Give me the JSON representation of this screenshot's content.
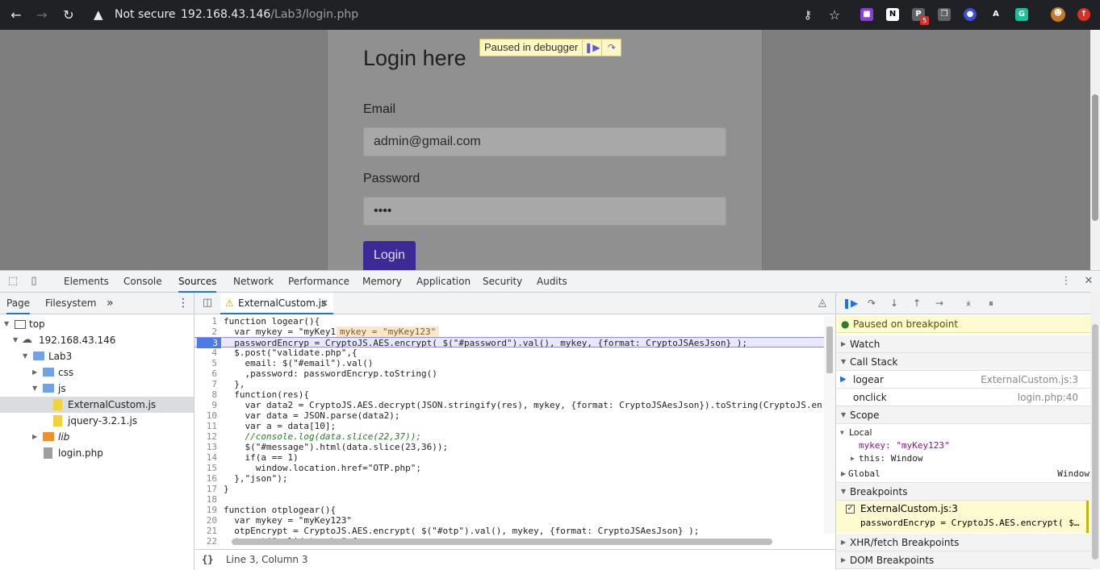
{
  "browser": {
    "url_warning": "Not secure",
    "url_host": "192.168.43.146",
    "url_path": "/Lab3/login.php",
    "ext_badge": "5"
  },
  "page": {
    "title": "Login here",
    "email_label": "Email",
    "email_value": "admin@gmail.com",
    "password_label": "Password",
    "password_value": "••••",
    "login_button": "Login",
    "paused_text": "Paused in debugger"
  },
  "devtools": {
    "tabs": [
      "Elements",
      "Console",
      "Sources",
      "Network",
      "Performance",
      "Memory",
      "Application",
      "Security",
      "Audits"
    ],
    "active_tab": "Sources",
    "navigator": {
      "tabs": [
        "Page",
        "Filesystem"
      ],
      "tree": [
        {
          "label": "top",
          "kind": "frame"
        },
        {
          "label": "192.168.43.146",
          "kind": "cloud"
        },
        {
          "label": "Lab3",
          "kind": "folder"
        },
        {
          "label": "css",
          "kind": "folder"
        },
        {
          "label": "js",
          "kind": "folder"
        },
        {
          "label": "ExternalCustom.js",
          "kind": "js"
        },
        {
          "label": "jquery-3.2.1.js",
          "kind": "js"
        },
        {
          "label": "lib",
          "kind": "folder-lib"
        },
        {
          "label": "login.php",
          "kind": "file"
        }
      ]
    },
    "editor": {
      "file_tab": "ExternalCustom.js",
      "status": "Line 3, Column 3",
      "lines": [
        {
          "n": "1",
          "text": "function logear(){"
        },
        {
          "n": "2",
          "text": "  var mykey = \"myKey123\";"
        },
        {
          "n": "3",
          "text": "  passwordEncryp = CryptoJS.AES.encrypt( $(\"#password\").val(), mykey, {format: CryptoJSAesJson} );"
        },
        {
          "n": "4",
          "text": "  $.post(\"validate.php\",{"
        },
        {
          "n": "5",
          "text": "    email: $(\"#email\").val()"
        },
        {
          "n": "6",
          "text": "    ,password: passwordEncryp.toString()"
        },
        {
          "n": "7",
          "text": "  },"
        },
        {
          "n": "8",
          "text": "  function(res){"
        },
        {
          "n": "9",
          "text": "    var data2 = CryptoJS.AES.decrypt(JSON.stringify(res), mykey, {format: CryptoJSAesJson}).toString(CryptoJS.en"
        },
        {
          "n": "10",
          "text": "    var data = JSON.parse(data2);"
        },
        {
          "n": "11",
          "text": "    var a = data[10];"
        },
        {
          "n": "12",
          "text": "    //console.log(data.slice(22,37));"
        },
        {
          "n": "13",
          "text": "    $(\"#message\").html(data.slice(23,36));"
        },
        {
          "n": "14",
          "text": "    if(a == 1)"
        },
        {
          "n": "15",
          "text": "      window.location.href=\"OTP.php\";"
        },
        {
          "n": "16",
          "text": "  },\"json\");"
        },
        {
          "n": "17",
          "text": "}"
        },
        {
          "n": "18",
          "text": ""
        },
        {
          "n": "19",
          "text": "function otplogear(){"
        },
        {
          "n": "20",
          "text": "  var mykey = \"myKey123\""
        },
        {
          "n": "21",
          "text": "  otpEncrypt = CryptoJS.AES.encrypt( $(\"#otp\").val(), mykey, {format: CryptoJSAesJson} );"
        },
        {
          "n": "22",
          "text": "  $.post(\"validate.php\",{"
        }
      ],
      "inline_value": "mykey = \"myKey123\""
    },
    "debugger": {
      "paused_msg": "Paused on breakpoint",
      "watch": "Watch",
      "call_stack": "Call Stack",
      "frames": [
        {
          "name": "logear",
          "loc": "ExternalCustom.js:3"
        },
        {
          "name": "onclick",
          "loc": "login.php:40"
        }
      ],
      "scope": "Scope",
      "local": "Local",
      "local_var": "mykey: \"myKey123\"",
      "this_var": "this: Window",
      "global": "Global",
      "global_val": "Window",
      "breakpoints": "Breakpoints",
      "bp_file": "ExternalCustom.js:3",
      "bp_code": "passwordEncryp = CryptoJS.AES.encrypt( $…",
      "xhr": "XHR/fetch Breakpoints",
      "dom": "DOM Breakpoints"
    }
  }
}
